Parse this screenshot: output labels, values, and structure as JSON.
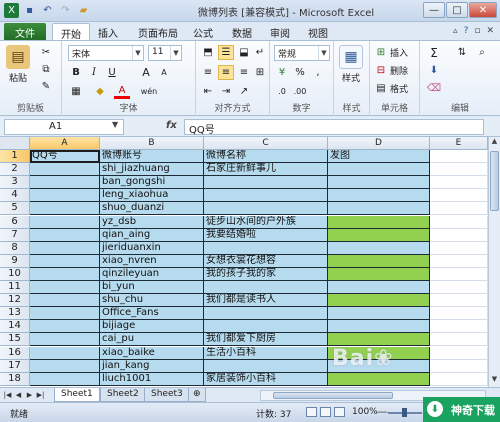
{
  "titlebar": {
    "title": "微博列表 [兼容模式] - Microsoft Excel",
    "qat_icons": [
      "excel-icon",
      "save-icon",
      "undo-icon",
      "redo-icon",
      "folder-icon"
    ],
    "window_buttons": [
      "—",
      "□",
      "✕"
    ]
  },
  "tabs": {
    "file": "文件",
    "items": [
      "开始",
      "插入",
      "页面布局",
      "公式",
      "数据",
      "审阅",
      "视图"
    ],
    "active": "开始"
  },
  "ribbon": {
    "clipboard": {
      "label": "剪贴板",
      "paste": "粘贴"
    },
    "font": {
      "label": "字体",
      "name": "宋体",
      "size": "11",
      "bold": "B",
      "italic": "I",
      "underline": "U",
      "grow": "A",
      "shrink": "A",
      "font_color": "A",
      "phonetic": "wén"
    },
    "alignment": {
      "label": "对齐方式"
    },
    "number": {
      "label": "数字",
      "format": "常规",
      "percent": "%",
      "comma": ","
    },
    "styles": {
      "label": "样式",
      "button": "样式"
    },
    "cells": {
      "label": "单元格",
      "insert": "插入",
      "delete": "删除",
      "format": "格式"
    },
    "editing": {
      "label": "编辑",
      "sum": "Σ"
    }
  },
  "formula_bar": {
    "name_box": "A1",
    "fx": "fx",
    "content": "QQ号"
  },
  "grid": {
    "columns": [
      "A",
      "B",
      "C",
      "D",
      "E"
    ],
    "headers": {
      "A": "QQ号",
      "B": "微博账号",
      "C": "微博名称",
      "D": "发图"
    },
    "rows": [
      {
        "n": "1",
        "a": "QQ号",
        "b": "微博账号",
        "c": "微博名称",
        "d": "发图"
      },
      {
        "n": "2",
        "a": "",
        "b": "shi_jiazhuang",
        "c": "石家庄新鲜事儿",
        "d": ""
      },
      {
        "n": "3",
        "a": "",
        "b": "ban_gongshi",
        "c": "",
        "d": ""
      },
      {
        "n": "4",
        "a": "",
        "b": "leng_xiaohua",
        "c": "",
        "d": ""
      },
      {
        "n": "5",
        "a": "",
        "b": "shuo_duanzi",
        "c": "",
        "d": ""
      },
      {
        "n": "6",
        "a": "",
        "b": "yz_dsb",
        "c": "徒步山水间的户外族",
        "d": ""
      },
      {
        "n": "7",
        "a": "",
        "b": "qian_aing",
        "c": "我要结婚啦",
        "d": ""
      },
      {
        "n": "8",
        "a": "",
        "b": "jieriduanxin",
        "c": "",
        "d": ""
      },
      {
        "n": "9",
        "a": "",
        "b": "xiao_nvren",
        "c": "女想衣裳花想容",
        "d": ""
      },
      {
        "n": "10",
        "a": "",
        "b": "qinzileyuan",
        "c": "我的孩子我的家",
        "d": ""
      },
      {
        "n": "11",
        "a": "",
        "b": "bi_yun",
        "c": "",
        "d": ""
      },
      {
        "n": "12",
        "a": "",
        "b": "shu_chu",
        "c": "我们都是读书人",
        "d": ""
      },
      {
        "n": "13",
        "a": "",
        "b": "Office_Fans",
        "c": "",
        "d": ""
      },
      {
        "n": "14",
        "a": "",
        "b": "bijiage",
        "c": "",
        "d": ""
      },
      {
        "n": "15",
        "a": "",
        "b": "cai_pu",
        "c": "我们都爱下厨房",
        "d": ""
      },
      {
        "n": "16",
        "a": "",
        "b": "xiao_baike",
        "c": "生活小百科",
        "d": ""
      },
      {
        "n": "17",
        "a": "",
        "b": "jian_kang",
        "c": "",
        "d": ""
      },
      {
        "n": "18",
        "a": "",
        "b": "liuch1001",
        "c": "家居装饰小百科",
        "d": ""
      }
    ],
    "green_d_rows": [
      6,
      7,
      9,
      10,
      12,
      15,
      16,
      18
    ]
  },
  "sheets": {
    "tabs": [
      "Sheet1",
      "Sheet2",
      "Sheet3"
    ],
    "active": "Sheet1"
  },
  "statusbar": {
    "mode": "就绪",
    "count": "计数: 37",
    "zoom": "100%",
    "zoom_minus": "—"
  },
  "watermark": "Bai度 经验",
  "logo": "神奇下载"
}
